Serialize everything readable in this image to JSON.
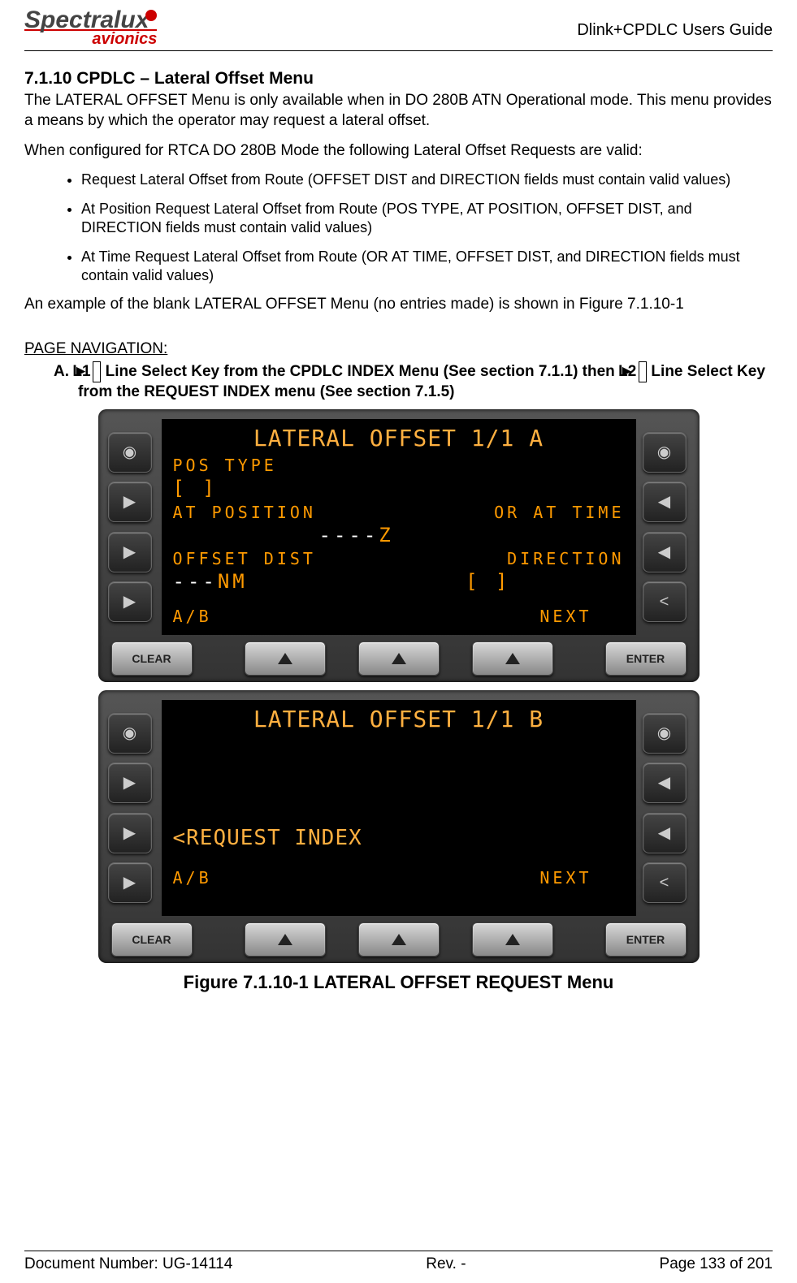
{
  "header": {
    "logo_top": "Spectralux",
    "logo_bottom": "avionics",
    "title": "Dlink+CPDLC Users Guide"
  },
  "section": {
    "number_title": "7.1.10 CPDLC – Lateral Offset Menu",
    "intro": "The LATERAL OFFSET Menu is only available when in DO 280B ATN Operational mode.  This menu provides a means by which the operator may request a lateral offset.",
    "config_line": "When configured for RTCA DO 280B Mode the following Lateral Offset Requests are valid:",
    "bullets": [
      "Request Lateral Offset from Route (OFFSET DIST and DIRECTION fields must contain valid values)",
      "At Position Request Lateral Offset from Route (POS TYPE, AT POSITION, OFFSET DIST, and DIRECTION fields must contain valid values)",
      "At Time Request Lateral Offset from Route (OR AT TIME, OFFSET DIST, and DIRECTION fields must contain valid values)"
    ],
    "example_line": "An example of the blank LATERAL OFFSET Menu (no entries made) is shown in Figure 7.1.10-1"
  },
  "nav": {
    "label": "PAGE NAVIGATION:",
    "step_prefix": "A.   ► ",
    "key1": "L1",
    "step_mid1": " Line Select Key from the CPDLC INDEX Menu (See section 7.1.1) then ► ",
    "key2": "L2",
    "step_mid2": " Line Select Key from the REQUEST INDEX menu (See section 7.1.5)"
  },
  "panelA": {
    "title": "LATERAL OFFSET 1/1 A",
    "pos_type_label": "POS TYPE",
    "pos_type_val": "[     ]",
    "at_position_label": "AT POSITION",
    "or_at_time_label": "OR AT TIME",
    "time_dashes": "----",
    "time_suffix": "Z",
    "offset_dist_label": "OFFSET DIST",
    "direction_label": "DIRECTION",
    "offset_dashes": "---",
    "offset_unit": "NM",
    "direction_val": "[   ]",
    "ab": "A/B",
    "next": "NEXT"
  },
  "panelB": {
    "title": "LATERAL OFFSET 1/1 B",
    "request_index": "<REQUEST INDEX",
    "ab": "A/B",
    "next": "NEXT"
  },
  "buttons": {
    "clear": "CLEAR",
    "enter": "ENTER"
  },
  "lsk_icons": {
    "circle": "◉",
    "play": "▶",
    "left": "◀",
    "back": "<"
  },
  "figure_caption": "Figure 7.1.10-1 LATERAL OFFSET REQUEST Menu",
  "footer": {
    "doc": "Document Number:  UG-14114",
    "rev": "Rev. -",
    "page": "Page 133 of 201"
  }
}
